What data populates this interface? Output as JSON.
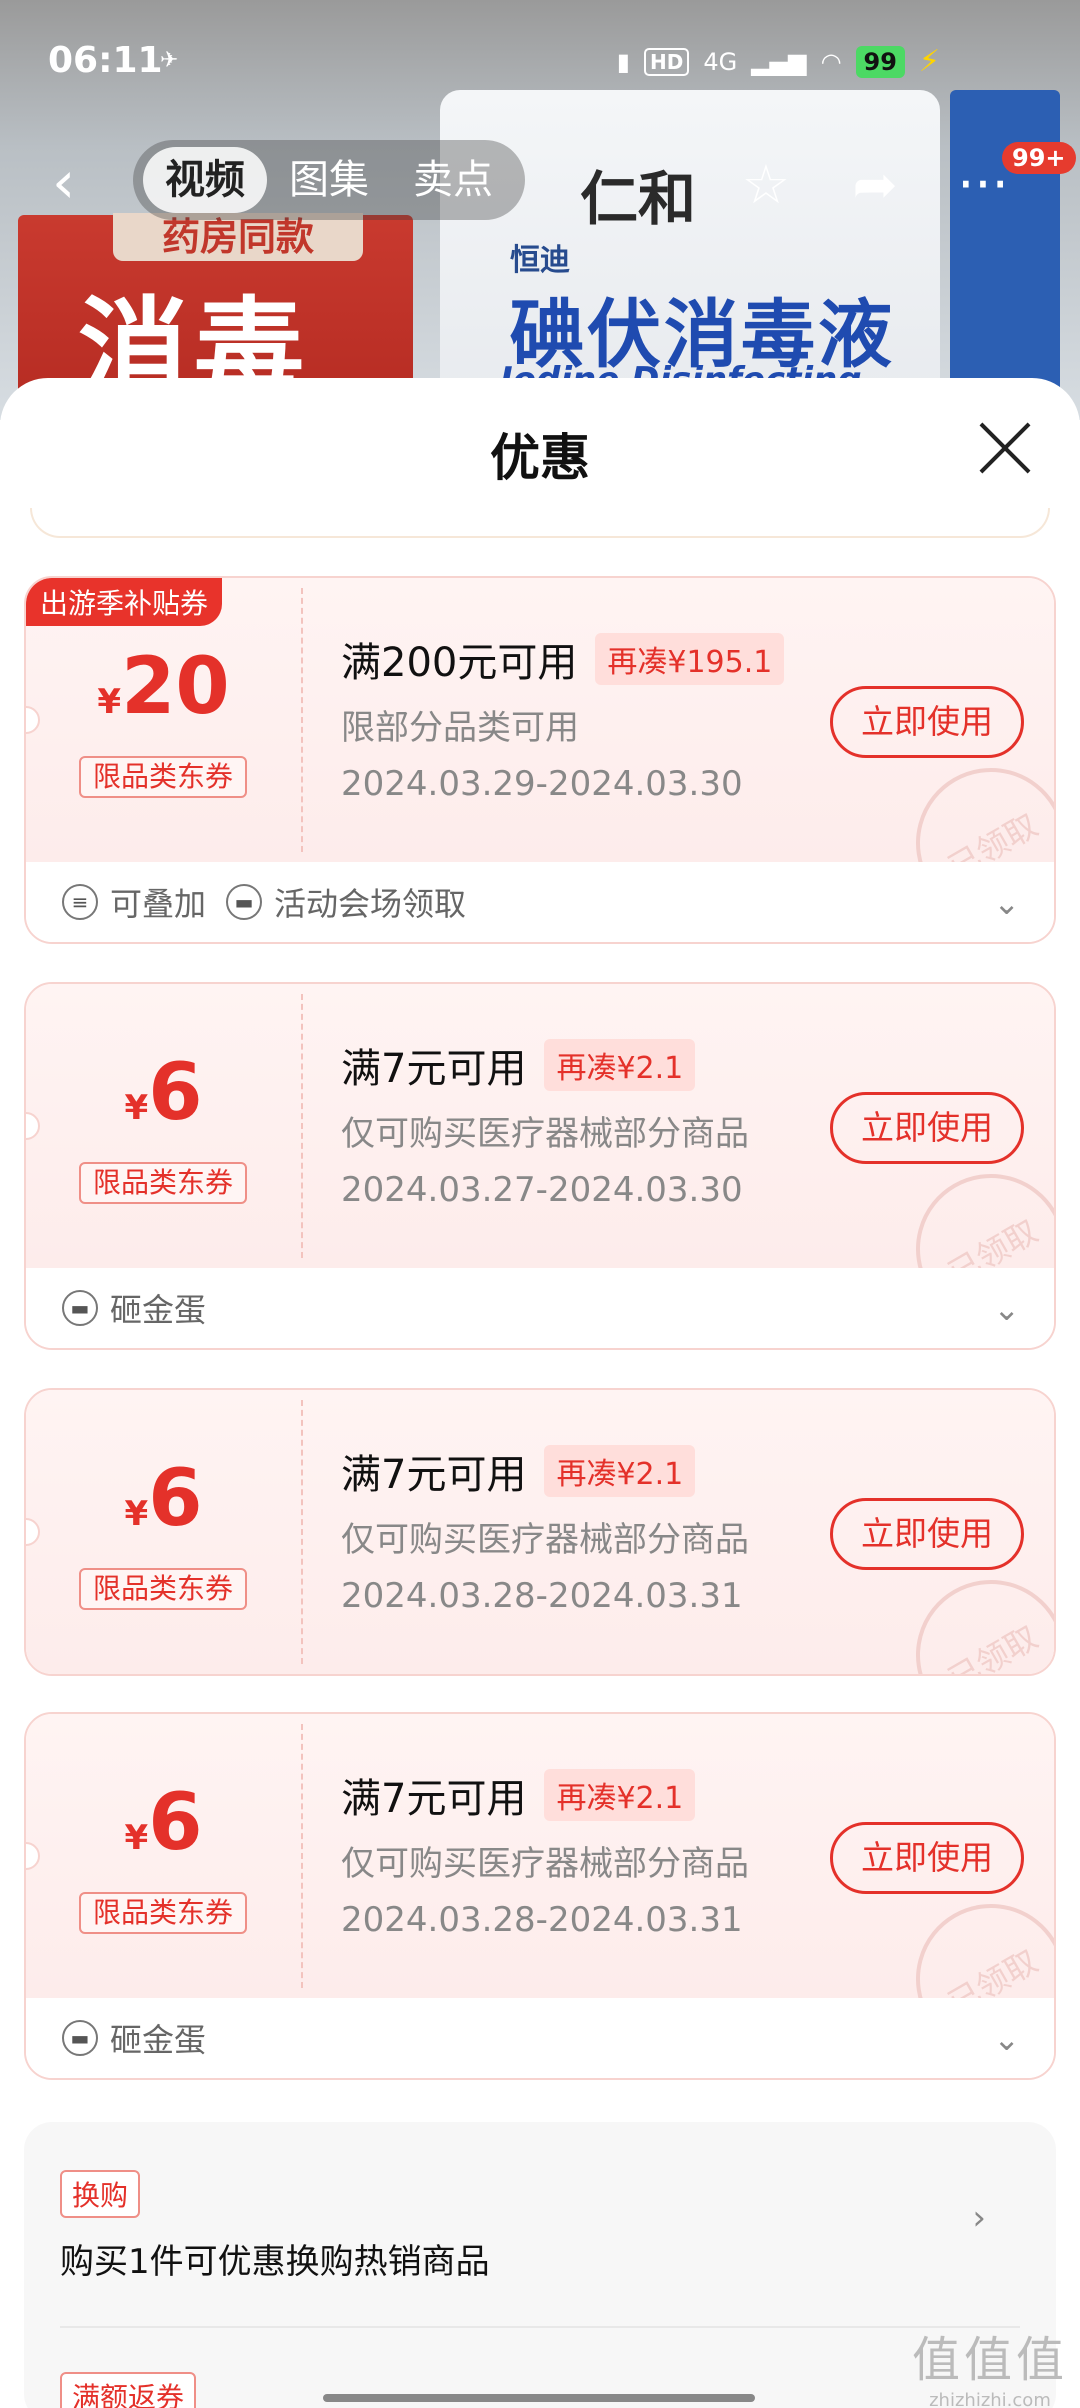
{
  "status_bar": {
    "time": "06:11",
    "network": "4G",
    "hd": "HD",
    "battery": "99"
  },
  "background": {
    "red_box_tag": "药房同款",
    "red_box_text": "消毒",
    "bottle_logo": "仁和",
    "bottle_brand": "恒迪",
    "bottle_title": "碘伏消毒液",
    "bottle_sub": "Iodine Disinfecting Solution"
  },
  "top_nav": {
    "tabs": [
      "视频",
      "图集",
      "卖点"
    ],
    "more_badge": "99+"
  },
  "sheet": {
    "title": "优惠"
  },
  "coupons": [
    {
      "corner_tag": "出游季补贴券",
      "currency": "¥",
      "amount": "20",
      "category": "限品类东券",
      "condition": "满200元可用",
      "gap": "再凑¥195.1",
      "scope": "限部分品类可用",
      "date": "2024.03.29-2024.03.30",
      "button": "立即使用",
      "stamp": "已领取",
      "features": [
        "可叠加",
        "活动会场领取"
      ]
    },
    {
      "currency": "¥",
      "amount": "6",
      "category": "限品类东券",
      "condition": "满7元可用",
      "gap": "再凑¥2.1",
      "scope": "仅可购买医疗器械部分商品",
      "date": "2024.03.27-2024.03.30",
      "button": "立即使用",
      "stamp": "已领取",
      "features": [
        "砸金蛋"
      ]
    },
    {
      "currency": "¥",
      "amount": "6",
      "category": "限品类东券",
      "condition": "满7元可用",
      "gap": "再凑¥2.1",
      "scope": "仅可购买医疗器械部分商品",
      "date": "2024.03.28-2024.03.31",
      "button": "立即使用",
      "stamp": "已领取"
    },
    {
      "currency": "¥",
      "amount": "6",
      "category": "限品类东券",
      "condition": "满7元可用",
      "gap": "再凑¥2.1",
      "scope": "仅可购买医疗器械部分商品",
      "date": "2024.03.28-2024.03.31",
      "button": "立即使用",
      "stamp": "已领取",
      "features": [
        "砸金蛋"
      ]
    }
  ],
  "promo": {
    "tag": "换购",
    "desc": "购买1件可优惠换购热销商品",
    "tag2": "满额返券"
  },
  "watermark": {
    "big": "值值值",
    "small": "zhizhizhi.com"
  }
}
